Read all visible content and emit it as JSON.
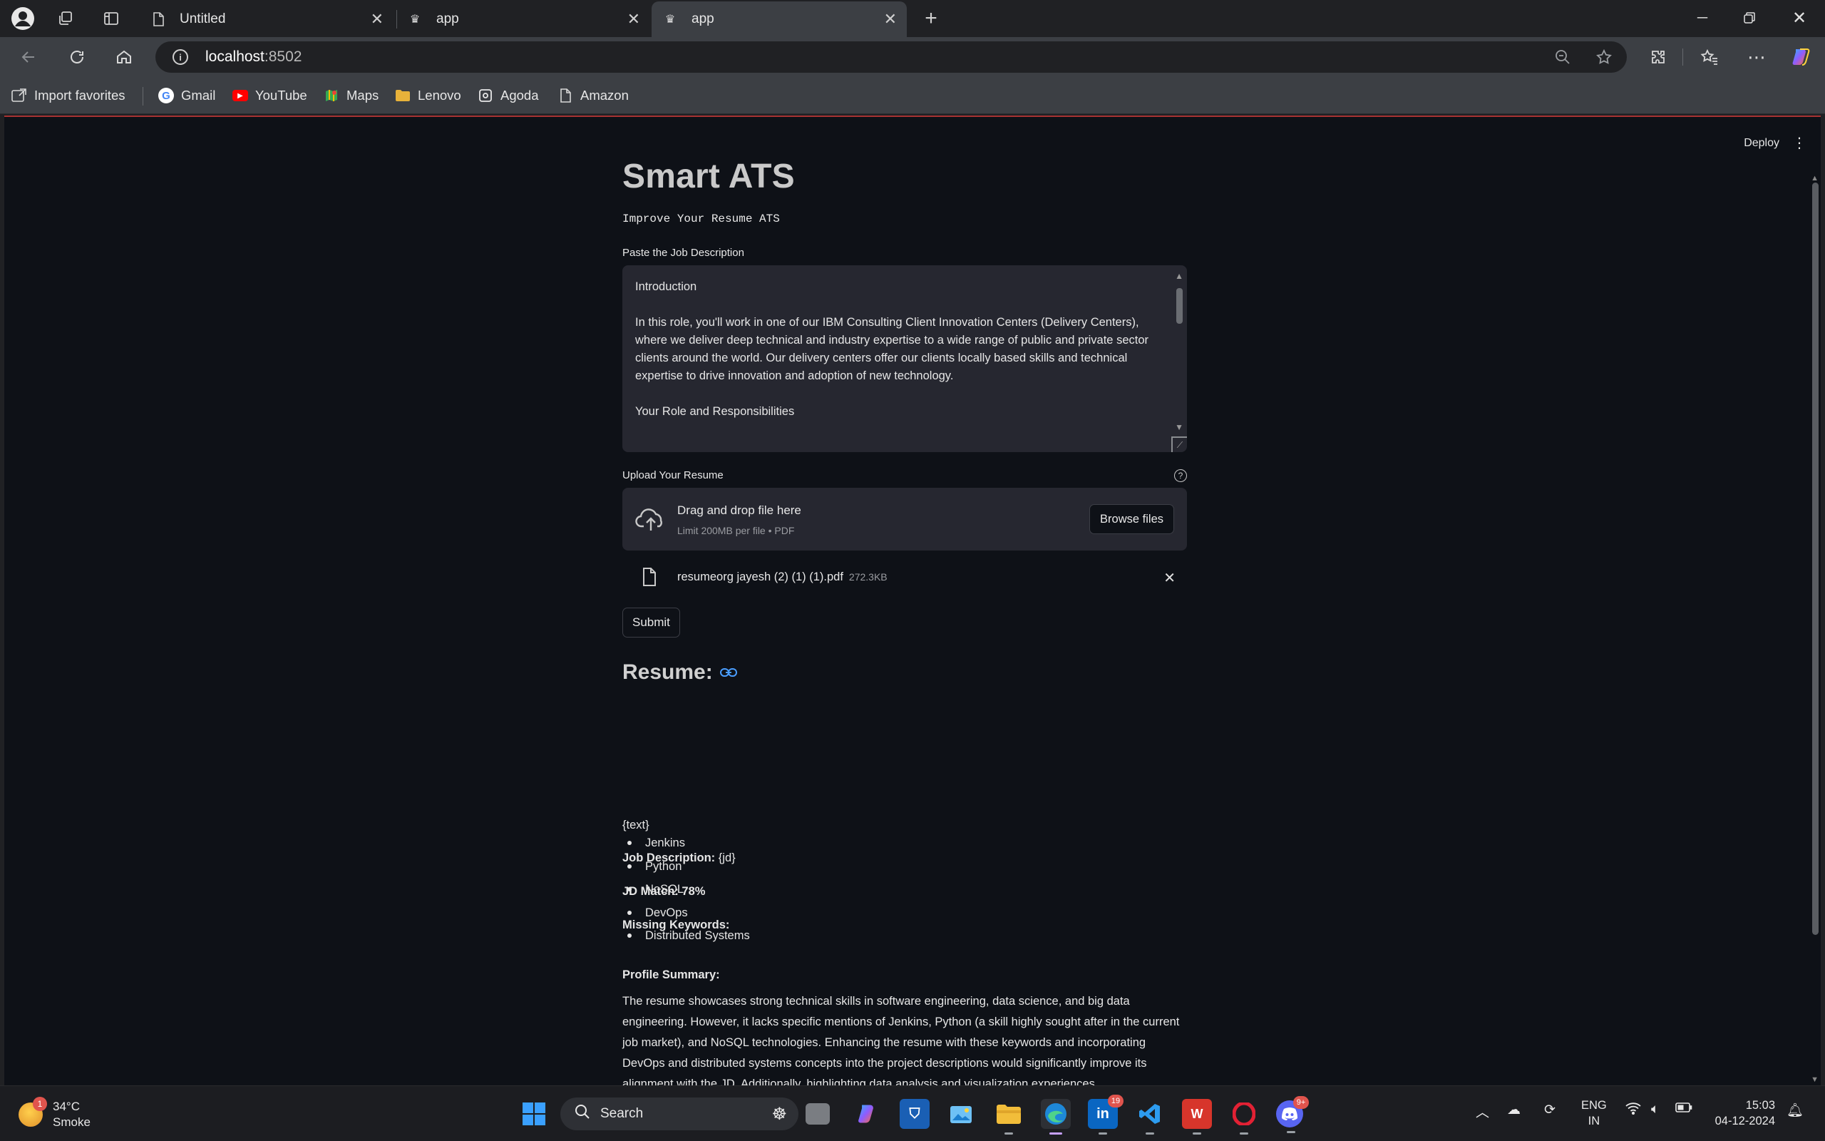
{
  "browser": {
    "tabs": [
      {
        "title": "Untitled"
      },
      {
        "title": "app"
      },
      {
        "title": "app"
      }
    ],
    "url_host": "localhost",
    "url_port": ":8502",
    "bookmarks": [
      {
        "label": "Import favorites",
        "icon": "import-favorites-icon"
      },
      {
        "label": "Gmail",
        "icon": "gmail-icon"
      },
      {
        "label": "YouTube",
        "icon": "youtube-icon"
      },
      {
        "label": "Maps",
        "icon": "maps-icon"
      },
      {
        "label": "Lenovo",
        "icon": "folder-icon"
      },
      {
        "label": "Agoda",
        "icon": "agoda-icon"
      },
      {
        "label": "Amazon",
        "icon": "page-icon"
      }
    ]
  },
  "app": {
    "deploy_label": "Deploy",
    "title": "Smart ATS",
    "subtitle": "Improve Your Resume ATS",
    "jd_label": "Paste the Job Description",
    "jd_text": "Introduction\n\nIn this role, you'll work in one of our IBM Consulting Client Innovation Centers (Delivery Centers), where we deliver deep technical and industry expertise to a wide range of public and private sector clients around the world. Our delivery centers offer our clients locally based skills and technical expertise to drive innovation and adoption of new technology.\n\nYour Role and Responsibilities",
    "upload_label": "Upload Your Resume",
    "dropzone_title": "Drag and drop file here",
    "dropzone_limit": "Limit 200MB per file • PDF",
    "browse_label": "Browse files",
    "file_name": "resumeorg jayesh (2) (1) (1).pdf",
    "file_size": "272.3KB",
    "submit_label": "Submit",
    "resume_heading": "Resume:",
    "text_placeholder": "{text}",
    "jd_heading": "Job Description:",
    "jd_value": " {jd}",
    "jd_match": "JD Match: 78%",
    "missing_heading": "Missing Keywords:",
    "missing_keywords": [
      "Jenkins",
      "Python",
      "NoSQL",
      "DevOps",
      "Distributed Systems"
    ],
    "profile_heading": "Profile Summary:",
    "profile_summary": "The resume showcases strong technical skills in software engineering, data science, and big data engineering. However, it lacks specific mentions of Jenkins, Python (a skill highly sought after in the current job market), and NoSQL technologies. Enhancing the resume with these keywords and incorporating DevOps and distributed systems concepts into the project descriptions would significantly improve its alignment with the JD. Additionally, highlighting data analysis and visualization experiences"
  },
  "taskbar": {
    "weather_temp": "34°C",
    "weather_desc": "Smoke",
    "weather_badge": "1",
    "search_label": "Search",
    "linkedin_badge": "19",
    "discord_badge": "9+",
    "lang_top": "ENG",
    "lang_bottom": "IN",
    "time": "15:03",
    "date": "04-12-2024"
  },
  "colors": {
    "page_bg": "#0e1117",
    "widget_bg": "#262730",
    "browser_chrome": "#3c3f44",
    "accent_link": "#4a9eff"
  }
}
